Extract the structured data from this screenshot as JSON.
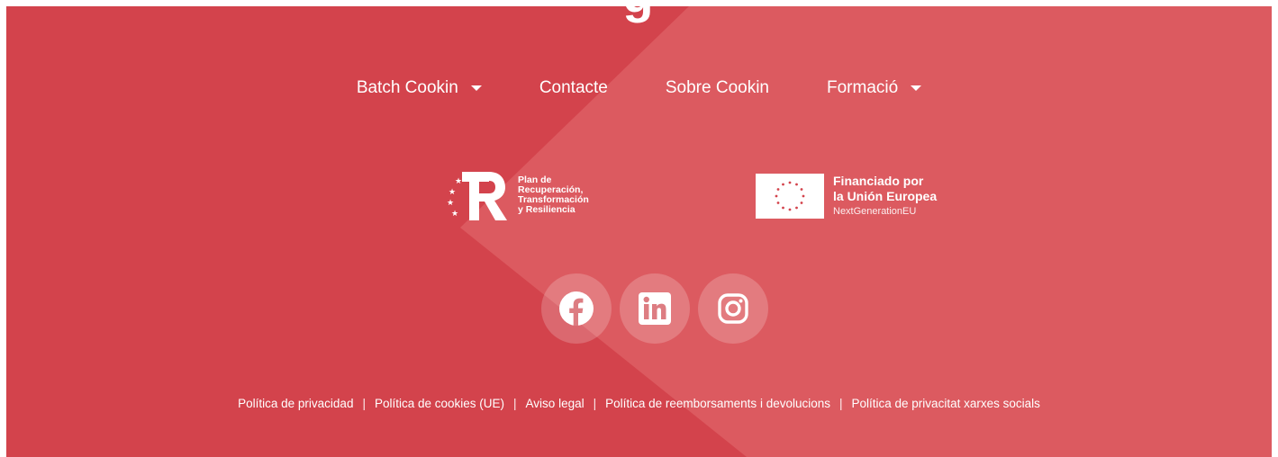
{
  "header": {
    "title_fragment": "g"
  },
  "nav": {
    "items": [
      {
        "label": "Batch Cookin",
        "has_dropdown": true
      },
      {
        "label": "Contacte",
        "has_dropdown": false
      },
      {
        "label": "Sobre Cookin",
        "has_dropdown": false
      },
      {
        "label": "Formació",
        "has_dropdown": true
      }
    ]
  },
  "logos": {
    "prtr": {
      "line1": "Plan de",
      "line2": "Recuperación,",
      "line3": "Transformación",
      "line4": "y Resiliencia"
    },
    "eu": {
      "line1": "Financiado por",
      "line2": "la Unión Europea",
      "line3": "NextGenerationEU"
    }
  },
  "social": [
    "facebook-icon",
    "linkedin-icon",
    "instagram-icon"
  ],
  "legal": {
    "links": [
      "Política de privacidad",
      "Política de cookies (UE)",
      "Aviso legal",
      "Política de reemborsaments i devolucions",
      "Política de privacitat xarxes socials"
    ],
    "separator": "|"
  },
  "colors": {
    "background": "#d3434c",
    "accent_shape": "#dc5a60",
    "text": "#ffffff",
    "eu_star": "#d3434c"
  }
}
